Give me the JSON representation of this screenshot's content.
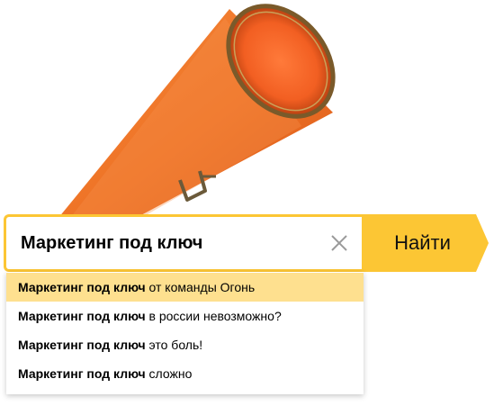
{
  "search": {
    "query": "Маркетинг под ключ",
    "button_label": "Найти",
    "clear_icon": "close-icon"
  },
  "suggestions": [
    {
      "bold": "Маркетинг под ключ",
      "rest": " от команды Огонь",
      "highlighted": true
    },
    {
      "bold": "Маркетинг под ключ",
      "rest": " в россии невозможно?",
      "highlighted": false
    },
    {
      "bold": "Маркетинг под ключ",
      "rest": " это боль!",
      "highlighted": false
    },
    {
      "bold": "Маркетинг под ключ",
      "rest": " сложно",
      "highlighted": false
    }
  ],
  "colors": {
    "accent": "#fcc634",
    "highlight": "#fee08f",
    "megaphone": "#f07a2a"
  }
}
